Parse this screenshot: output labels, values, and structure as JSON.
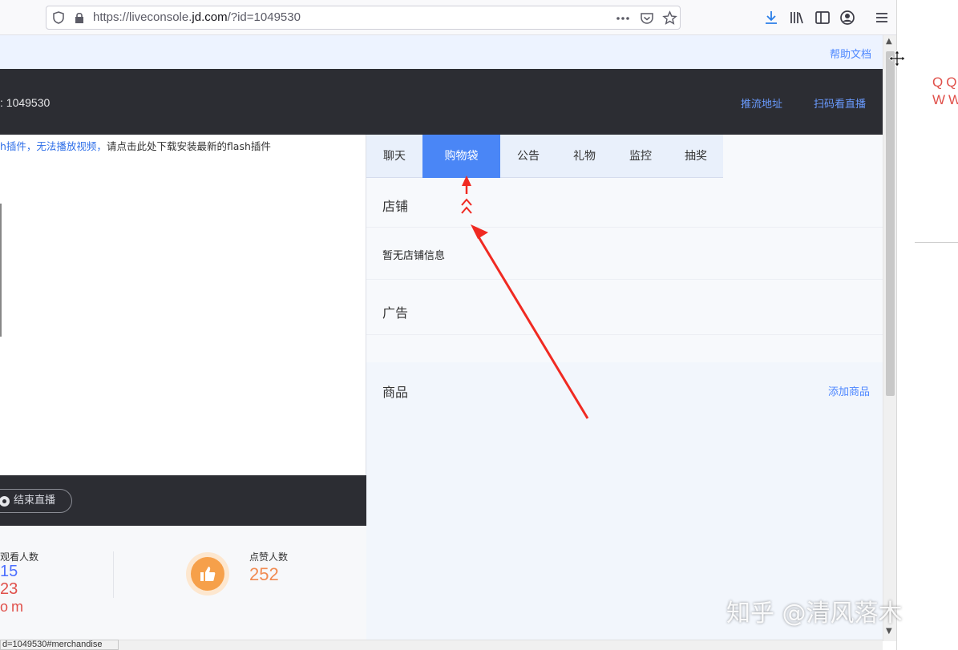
{
  "browser": {
    "url_prefix": "https://liveconsole.",
    "url_domain": "jd.com",
    "url_suffix": "/?id=1049530",
    "icons": [
      "shield-icon",
      "lock-icon",
      "more-icon",
      "pocket-icon",
      "star-icon",
      "download-icon",
      "library-icon",
      "sidebar-icon",
      "account-icon",
      "menu-icon"
    ]
  },
  "help": {
    "label": "帮助文档"
  },
  "header": {
    "room_id": ": 1049530",
    "push_url": "推流地址",
    "scan_watch": "扫码看直播"
  },
  "video": {
    "flash_warning": "h插件，无法播放视频，",
    "flash_action": "请点击此处下载安装最新的flash插件",
    "end_live": "结束直播"
  },
  "stats": {
    "viewers_label": "观看人数",
    "viewers_value": "15",
    "likes_label": "点赞人数",
    "likes_value": "252"
  },
  "tabs": [
    {
      "label": "聊天",
      "active": false
    },
    {
      "label": "购物袋",
      "active": true
    },
    {
      "label": "公告",
      "active": false
    },
    {
      "label": "礼物",
      "active": false
    },
    {
      "label": "监控",
      "active": false
    },
    {
      "label": "抽奖",
      "active": false
    }
  ],
  "store": {
    "title": "店铺",
    "empty": "暂无店铺信息"
  },
  "ad": {
    "title": "广告"
  },
  "goods": {
    "title": "商品",
    "add": "添加商品"
  },
  "status_bar": "d=1049530#merchandise",
  "watermarks": {
    "qq": "QQ\nWW",
    "mid_23": "23",
    "mid_om": "om",
    "zhihu": "知乎 @清风落木"
  },
  "colors": {
    "accent": "#4a86f6",
    "dark": "#2c2d33",
    "arrow": "#f02a22",
    "like": "#f18b52"
  }
}
